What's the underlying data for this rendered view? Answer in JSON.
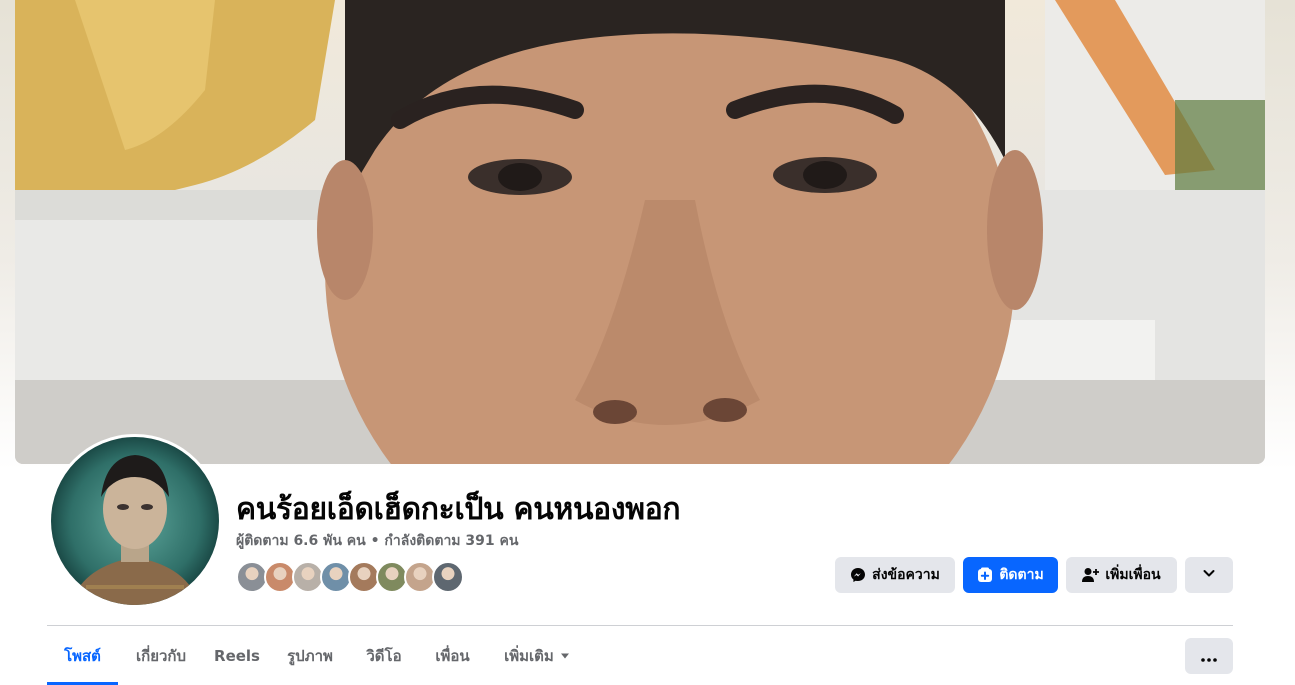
{
  "profile": {
    "name": "คนร้อยเอ็ดเฮ็ดกะเป็น คนหนองพอก",
    "stats": "ผู้ติดตาม 6.6 พัน คน • กำลังติดตาม 391 คน"
  },
  "friends_preview": [
    {
      "name": "friend-avatar-1",
      "color": "#8a8f96"
    },
    {
      "name": "friend-avatar-2",
      "color": "#c98a6a"
    },
    {
      "name": "friend-avatar-3",
      "color": "#b8b0a8"
    },
    {
      "name": "friend-avatar-4",
      "color": "#6f8fa8"
    },
    {
      "name": "friend-avatar-5",
      "color": "#a47a5c"
    },
    {
      "name": "friend-avatar-6",
      "color": "#7f8a5e"
    },
    {
      "name": "friend-avatar-7",
      "color": "#c4a48c"
    },
    {
      "name": "friend-avatar-8",
      "color": "#5e6770"
    }
  ],
  "actions": {
    "message_label": "ส่งข้อความ",
    "follow_label": "ติดตาม",
    "add_friend_label": "เพิ่มเพื่อน"
  },
  "tabs": [
    {
      "label": "โพสต์",
      "active": true
    },
    {
      "label": "เกี่ยวกับ",
      "active": false
    },
    {
      "label": "Reels",
      "active": false
    },
    {
      "label": "รูปภาพ",
      "active": false
    },
    {
      "label": "วิดีโอ",
      "active": false
    },
    {
      "label": "เพื่อน",
      "active": false
    },
    {
      "label": "เพิ่มเติม",
      "active": false
    }
  ],
  "icons": {
    "message": "messenger-icon",
    "follow": "follow-icon",
    "add_friend": "add-friend-icon",
    "dropdown": "chevron-down-icon",
    "more": "more-dots-icon"
  },
  "colors": {
    "accent": "#0866ff",
    "button_gray": "#e4e6eb",
    "text_primary": "#050505",
    "text_secondary": "#65676b"
  }
}
